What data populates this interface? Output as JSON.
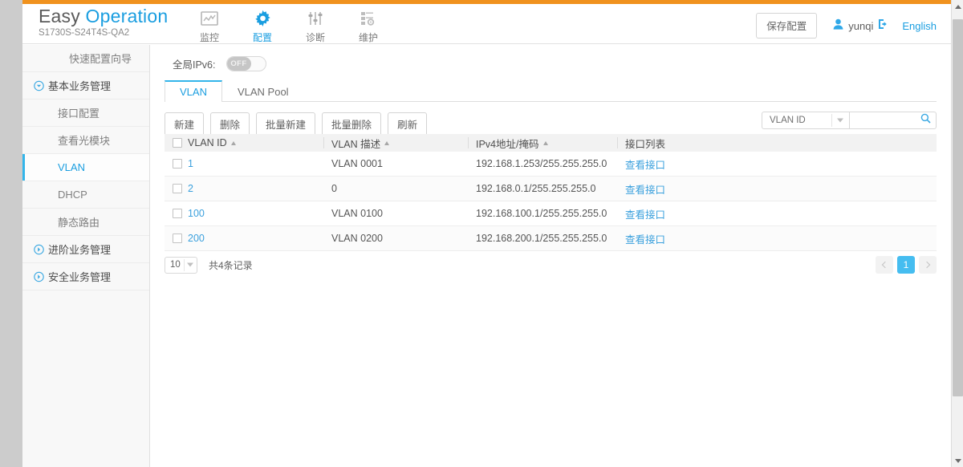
{
  "header": {
    "brand_first": "Easy ",
    "brand_second": "Operation",
    "model": "S1730S-S24T4S-QA2",
    "nav": [
      {
        "label": "监控",
        "icon": "monitor-icon",
        "active": false
      },
      {
        "label": "配置",
        "icon": "gear-icon",
        "active": true
      },
      {
        "label": "诊断",
        "icon": "sliders-icon",
        "active": false
      },
      {
        "label": "维护",
        "icon": "maintenance-icon",
        "active": false
      }
    ],
    "save_label": "保存配置",
    "user_name": "yunqi",
    "logout_icon": "logout-icon",
    "user_icon": "user-icon",
    "language_label": "English"
  },
  "sidebar": {
    "items": [
      {
        "label": "快速配置向导",
        "type": "plain",
        "active": false
      },
      {
        "label": "基本业务管理",
        "type": "group-open",
        "active": false
      },
      {
        "label": "接口配置",
        "type": "child",
        "active": false
      },
      {
        "label": "查看光模块",
        "type": "child",
        "active": false
      },
      {
        "label": "VLAN",
        "type": "child",
        "active": true
      },
      {
        "label": "DHCP",
        "type": "child",
        "active": false
      },
      {
        "label": "静态路由",
        "type": "child",
        "active": false
      },
      {
        "label": "进阶业务管理",
        "type": "group-closed",
        "active": false
      },
      {
        "label": "安全业务管理",
        "type": "group-closed",
        "active": false
      }
    ]
  },
  "main": {
    "ipv6": {
      "label": "全局IPv6:",
      "state": "OFF"
    },
    "tabs": [
      {
        "label": "VLAN",
        "active": true
      },
      {
        "label": "VLAN Pool",
        "active": false
      }
    ],
    "toolbar": [
      {
        "label": "新建"
      },
      {
        "label": "删除"
      },
      {
        "label": "批量新建"
      },
      {
        "label": "批量删除"
      },
      {
        "label": "刷新"
      }
    ],
    "search": {
      "select_value": "VLAN ID",
      "input_value": "",
      "input_placeholder": ""
    },
    "table": {
      "columns": [
        {
          "label": "VLAN ID",
          "sortable": true
        },
        {
          "label": "VLAN 描述",
          "sortable": true
        },
        {
          "label": "IPv4地址/掩码",
          "sortable": true
        },
        {
          "label": "接口列表",
          "sortable": false
        }
      ],
      "rows": [
        {
          "vlan_id": "1",
          "desc": "VLAN 0001",
          "ipv4": "192.168.1.253/255.255.255.0",
          "ports_link": "查看接口"
        },
        {
          "vlan_id": "2",
          "desc": "0",
          "ipv4": "192.168.0.1/255.255.255.0",
          "ports_link": "查看接口"
        },
        {
          "vlan_id": "100",
          "desc": "VLAN 0100",
          "ipv4": "192.168.100.1/255.255.255.0",
          "ports_link": "查看接口"
        },
        {
          "vlan_id": "200",
          "desc": "VLAN 0200",
          "ipv4": "192.168.200.1/255.255.255.0",
          "ports_link": "查看接口"
        }
      ]
    },
    "footer": {
      "page_size": "10",
      "total_text": "共4条记录",
      "pages": [
        "1"
      ],
      "prev_icon": "chevron-left-icon",
      "next_icon": "chevron-right-icon"
    }
  },
  "colors": {
    "accent_orange": "#f0921e",
    "accent_blue": "#1a9ee0",
    "page_active_blue": "#45bdf0"
  }
}
